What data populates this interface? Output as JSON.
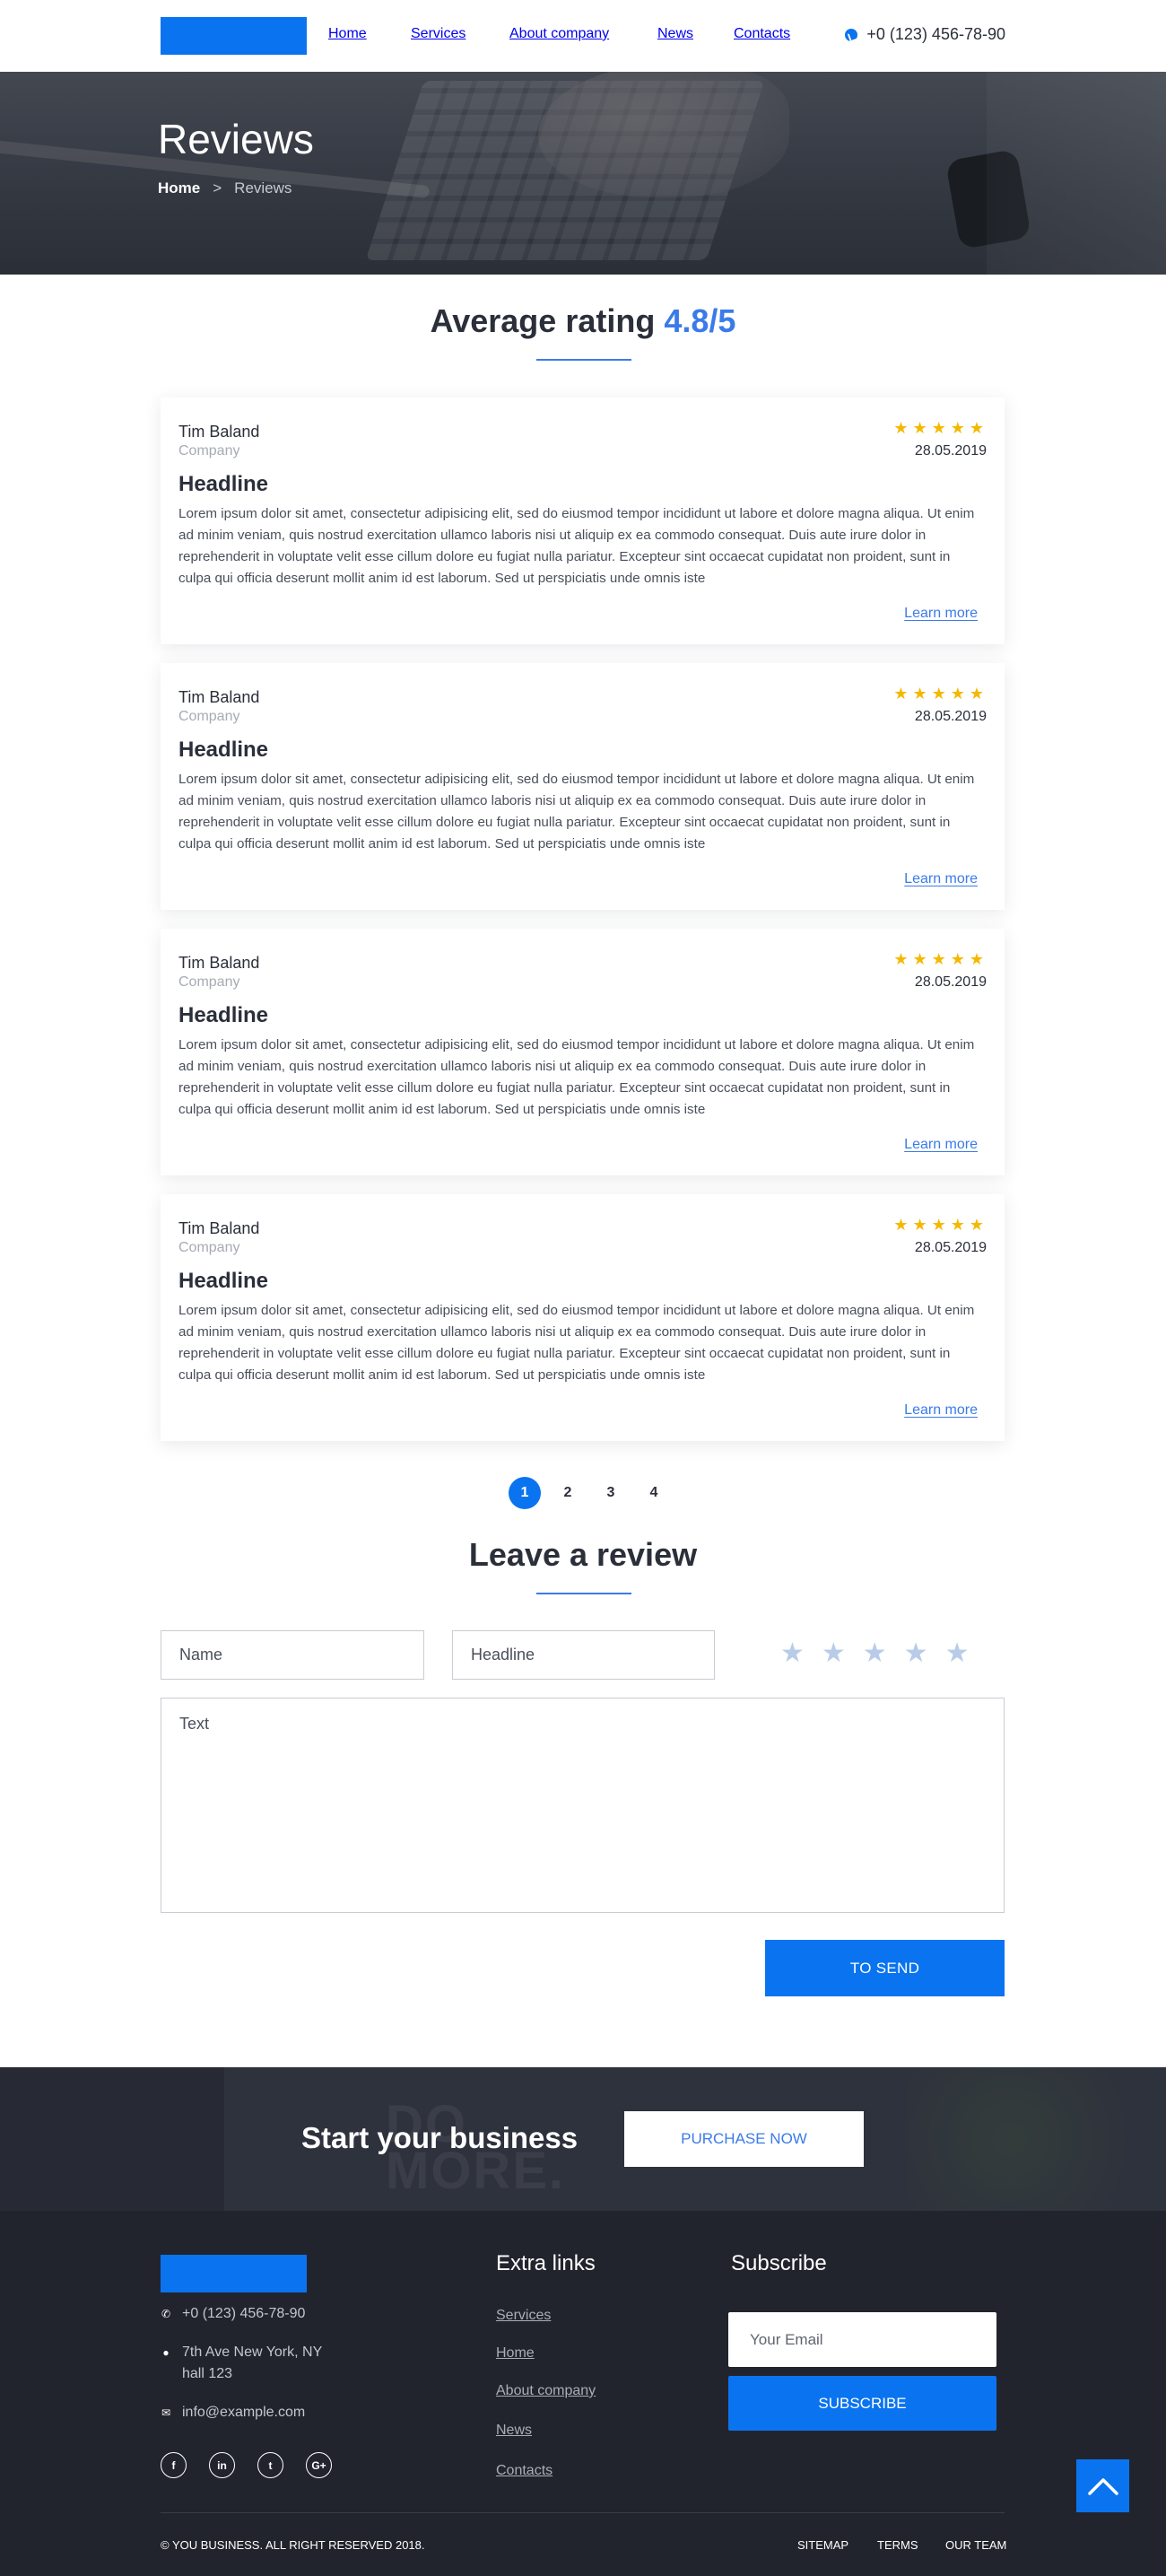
{
  "header": {
    "nav": [
      "Home",
      "Services",
      "About company",
      "News",
      "Contacts"
    ],
    "phone": "+0 (123) 456-78-90",
    "phone_icon": "phone-icon"
  },
  "hero": {
    "title": "Reviews",
    "breadcrumb_home": "Home",
    "breadcrumb_separator": ">",
    "breadcrumb_current": "Reviews"
  },
  "rating": {
    "label": "Average rating",
    "value": "4.8/5"
  },
  "reviews": [
    {
      "author": "Tim Baland",
      "company": "Company",
      "stars": "★★★★★",
      "date": "28.05.2019",
      "headline": "Headline",
      "body": "Lorem ipsum dolor sit amet, consectetur adipisicing elit, sed do eiusmod tempor incididunt ut labore et dolore magna aliqua. Ut enim ad minim veniam, quis nostrud exercitation ullamco laboris nisi ut aliquip ex ea commodo consequat. Duis aute irure dolor in reprehenderit in voluptate velit esse cillum dolore eu fugiat nulla pariatur. Excepteur sint occaecat cupidatat non proident, sunt in culpa qui officia deserunt mollit anim id est laborum. Sed ut perspiciatis unde omnis iste",
      "link": "Learn more"
    },
    {
      "author": "Tim Baland",
      "company": "Company",
      "stars": "★★★★★",
      "date": "28.05.2019",
      "headline": "Headline",
      "body": "Lorem ipsum dolor sit amet, consectetur adipisicing elit, sed do eiusmod tempor incididunt ut labore et dolore magna aliqua. Ut enim ad minim veniam, quis nostrud exercitation ullamco laboris nisi ut aliquip ex ea commodo consequat. Duis aute irure dolor in reprehenderit in voluptate velit esse cillum dolore eu fugiat nulla pariatur. Excepteur sint occaecat cupidatat non proident, sunt in culpa qui officia deserunt mollit anim id est laborum. Sed ut perspiciatis unde omnis iste",
      "link": "Learn more"
    },
    {
      "author": "Tim Baland",
      "company": "Company",
      "stars": "★★★★★",
      "date": "28.05.2019",
      "headline": "Headline",
      "body": "Lorem ipsum dolor sit amet, consectetur adipisicing elit, sed do eiusmod tempor incididunt ut labore et dolore magna aliqua. Ut enim ad minim veniam, quis nostrud exercitation ullamco laboris nisi ut aliquip ex ea commodo consequat. Duis aute irure dolor in reprehenderit in voluptate velit esse cillum dolore eu fugiat nulla pariatur. Excepteur sint occaecat cupidatat non proident, sunt in culpa qui officia deserunt mollit anim id est laborum. Sed ut perspiciatis unde omnis iste",
      "link": "Learn more"
    },
    {
      "author": "Tim Baland",
      "company": "Company",
      "stars": "★★★★★",
      "date": "28.05.2019",
      "headline": "Headline",
      "body": "Lorem ipsum dolor sit amet, consectetur adipisicing elit, sed do eiusmod tempor incididunt ut labore et dolore magna aliqua. Ut enim ad minim veniam, quis nostrud exercitation ullamco laboris nisi ut aliquip ex ea commodo consequat. Duis aute irure dolor in reprehenderit in voluptate velit esse cillum dolore eu fugiat nulla pariatur. Excepteur sint occaecat cupidatat non proident, sunt in culpa qui officia deserunt mollit anim id est laborum. Sed ut perspiciatis unde omnis iste",
      "link": "Learn more"
    }
  ],
  "pagination": {
    "pages": [
      "1",
      "2",
      "3",
      "4"
    ],
    "current": "1"
  },
  "review_form": {
    "title": "Leave a review",
    "name_placeholder": "Name",
    "headline_placeholder": "Headline",
    "text_placeholder": "Text",
    "rating_stars": "★★★★★",
    "submit_label": "TO SEND"
  },
  "cta": {
    "text": "Start your business",
    "button": "PURCHASE NOW",
    "background_sign": "DO MORE."
  },
  "footer": {
    "phone": "+0 (123) 456-78-90",
    "address_line1": "7th Ave New York, NY",
    "address_line2": "hall 123",
    "email": "info@example.com",
    "socials": [
      "f",
      "in",
      "t",
      "G+"
    ],
    "extra_links_title": "Extra links",
    "extra_links": [
      "Services",
      "Home",
      "About company",
      "News",
      "Contacts"
    ],
    "subscribe_title": "Subscribe",
    "email_placeholder": "Your Email",
    "subscribe_button": "SUBSCRIBE",
    "copyright": "© YOU BUSINESS. ALL RIGHT RESERVED 2018.",
    "legal_links": [
      "SITEMAP",
      "TERMS",
      "OUR TEAM"
    ]
  },
  "colors": {
    "accent": "#0a74f0",
    "accent_text": "#3b7be8",
    "star": "#f5b800",
    "footer_bg": "#22242d"
  }
}
